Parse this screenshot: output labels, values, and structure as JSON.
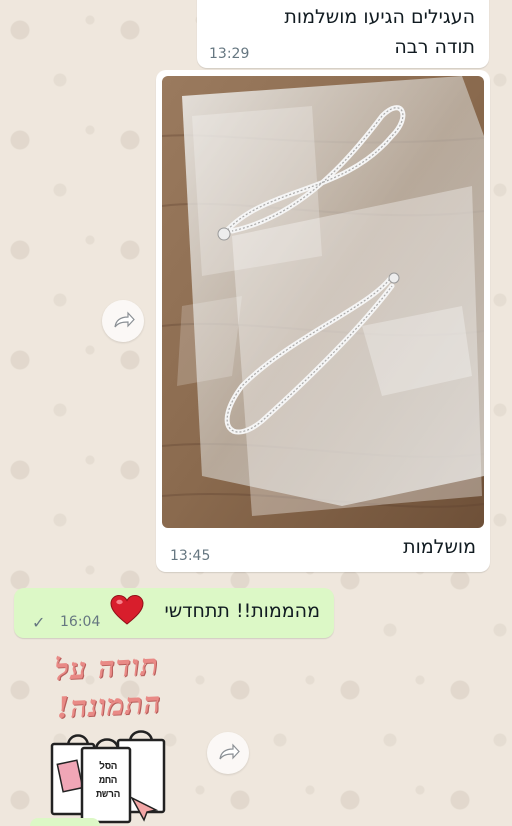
{
  "chat": {
    "messages": [
      {
        "direction": "incoming",
        "lines": [
          "העגילים הגיעו מושלמות",
          "תודה רבה"
        ],
        "time": "13:29"
      },
      {
        "direction": "incoming",
        "attachment": "photo",
        "caption": "מושלמות",
        "time": "13:45"
      },
      {
        "direction": "outgoing",
        "text": "מהממות!! תתחדשי",
        "emoji": "red-heart",
        "time": "16:04",
        "status": "sent-check"
      }
    ],
    "sticker": {
      "line1": "תודה על",
      "line2": "התמונה!",
      "bag_text": [
        "הסל",
        "החמ",
        "הרשת"
      ]
    }
  },
  "colors": {
    "wallpaper": "#efe7dd",
    "incoming_bubble": "#ffffff",
    "outgoing_bubble": "#dcf8c6",
    "timestamp": "#667781",
    "sticker_text": "#e98a86",
    "heart": "#d81e2c"
  },
  "icons": {
    "forward": "forward-arrow-icon",
    "check": "check-icon",
    "heart": "heart-icon"
  }
}
